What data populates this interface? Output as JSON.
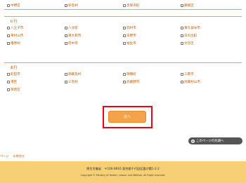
{
  "top_row": [
    "中野区",
    "秋島村",
    "昌果京町",
    "藤飯区"
  ],
  "sections": [
    {
      "title": "ｂ行",
      "items": [
        "八王子市",
        "八丈町",
        "羽村市",
        "東久留米市",
        "東村山市",
        "東大和市",
        "日野市",
        "日の出町",
        "檜原村",
        "府中市",
        "福生市",
        "文京区"
      ]
    },
    {
      "title": "ま行",
      "items": [
        "町田市",
        "御蔵島村",
        "瑞穂町",
        "三鷹市",
        "港区",
        "三宅村",
        "武蔵野市",
        "武蔵村山市",
        "目黒区"
      ]
    }
  ],
  "next_button": "次へ",
  "pagetop": {
    "icon": "▲",
    "label": "このページの先頭へ"
  },
  "footer_links": [
    "ページ",
    "お問合せ"
  ],
  "footer": {
    "address": "厚生労働省　〒100-8916 東京都千代田区霞が関1-2-2",
    "copyright": "Copyright © Ministry of Health, Labour and Welfare, All Right reserved."
  }
}
